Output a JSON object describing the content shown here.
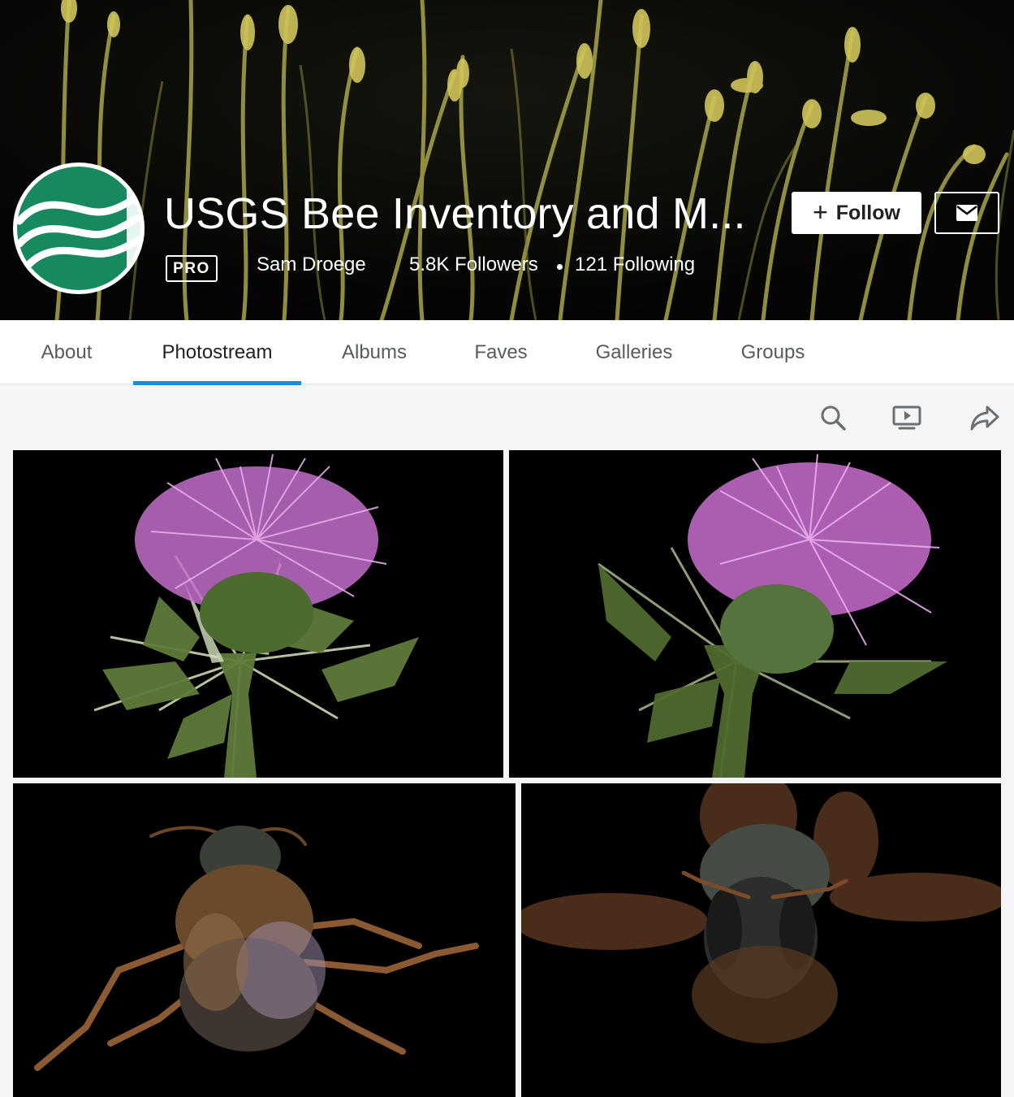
{
  "profile": {
    "name": "USGS Bee Inventory and M...",
    "badge": "PRO",
    "owner": "Sam Droege",
    "followers": "5.8K Followers",
    "following": "121 Following",
    "follow_label": "Follow",
    "follow_icon": "plus-icon",
    "message_icon": "mail-icon"
  },
  "tabs": [
    {
      "label": "About",
      "active": false
    },
    {
      "label": "Photostream",
      "active": true
    },
    {
      "label": "Albums",
      "active": false
    },
    {
      "label": "Faves",
      "active": false
    },
    {
      "label": "Galleries",
      "active": false
    },
    {
      "label": "Groups",
      "active": false
    }
  ],
  "toolbar": {
    "icons": [
      "search-icon",
      "slideshow-icon",
      "share-icon"
    ]
  },
  "photos": [
    {
      "subject": "thistle-flower"
    },
    {
      "subject": "thistle-flower"
    },
    {
      "subject": "bee-dorsal"
    },
    {
      "subject": "bee-face"
    }
  ],
  "colors": {
    "tab_active_underline": "#128fdc",
    "tab_text": "#555b5f",
    "page_bg": "#f3f5f6",
    "logo_green": "#168a5e"
  }
}
